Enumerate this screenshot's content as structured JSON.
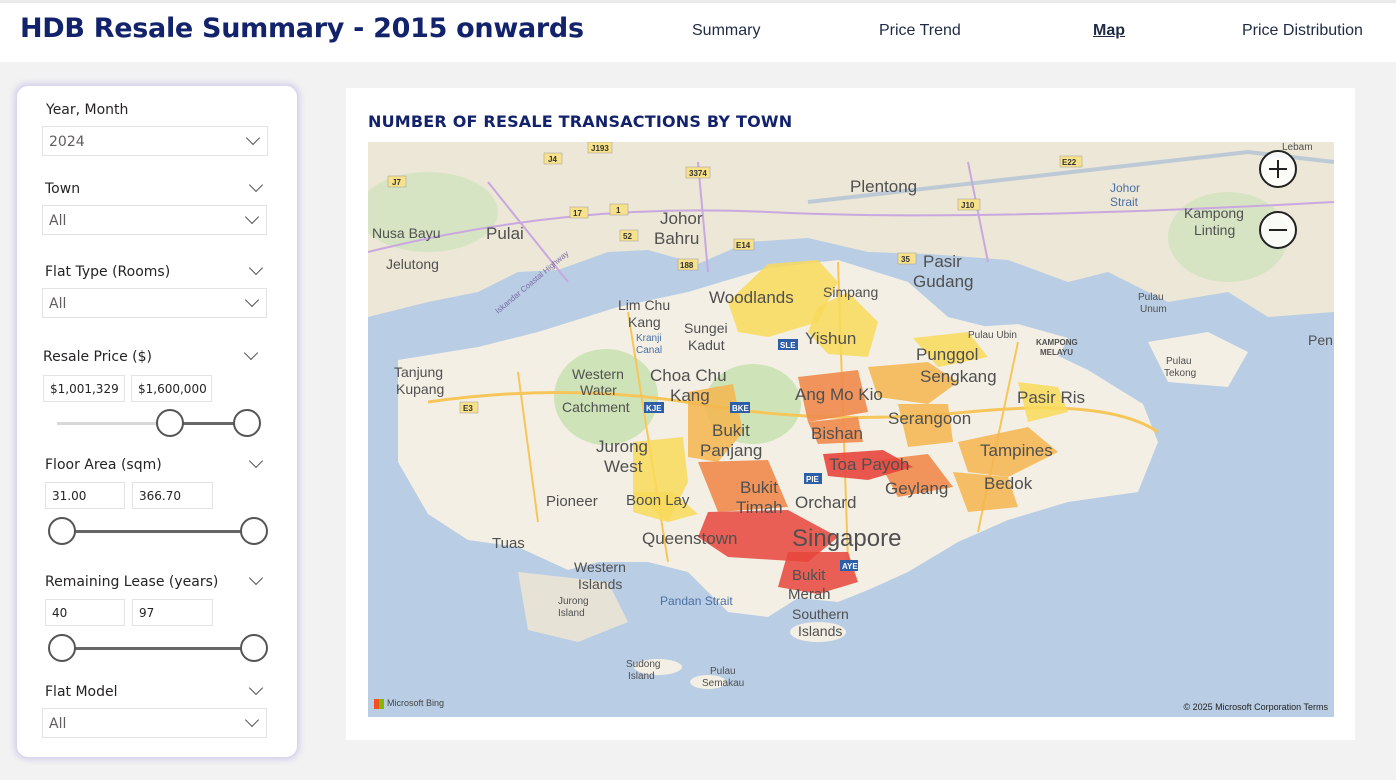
{
  "header": {
    "title": "HDB Resale Summary - 2015 onwards",
    "nav": [
      "Summary",
      "Price Trend",
      "Map",
      "Price Distribution"
    ],
    "active_tab": "Map"
  },
  "filters": {
    "year_month": {
      "label": "Year, Month",
      "value": "2024"
    },
    "town": {
      "label": "Town",
      "value": "All"
    },
    "flat_type": {
      "label": "Flat Type (Rooms)",
      "value": "All"
    },
    "resale_price": {
      "label": "Resale Price ($)",
      "min": "$1,001,329",
      "max": "$1,600,000",
      "low_fraction": 0.6,
      "high_fraction": 1.0
    },
    "floor_area": {
      "label": "Floor Area (sqm)",
      "min": "31.00",
      "max": "366.70",
      "low_fraction": 0.0,
      "high_fraction": 1.0
    },
    "remaining_lease": {
      "label": "Remaining Lease (years)",
      "min": "40",
      "max": "97",
      "low_fraction": 0.0,
      "high_fraction": 1.0
    },
    "flat_model": {
      "label": "Flat Model",
      "value": "All"
    }
  },
  "map_card": {
    "title": "NUMBER OF RESALE TRANSACTIONS BY TOWN",
    "attribution_left": "Microsoft Bing",
    "attribution_right": "© 2025 Microsoft Corporation  Terms",
    "zoom_in_icon": "plus-icon",
    "zoom_out_icon": "minus-icon",
    "place_labels": [
      "Plentong",
      "Johor Bahru",
      "Pulai",
      "Nusa Bayu",
      "Jelutong",
      "Johor Strait",
      "Kampong Linting",
      "Pasir Gudang",
      "Woodlands",
      "Simpang",
      "Yishun",
      "Lim Chu Kang",
      "Sungei Kadut",
      "Kranji Canal",
      "Pulau Ubin",
      "Kampong Melayu",
      "Pulau Unum",
      "Pulau Tekong",
      "Punggol",
      "Sengkang",
      "Tanjung Kupang",
      "Western Water Catchment",
      "Choa Chu Kang",
      "Ang Mo Kio",
      "Serangoon",
      "Pasir Ris",
      "Bishan",
      "Jurong West",
      "Bukit Panjang",
      "Toa Payoh",
      "Tampines",
      "Pioneer",
      "Boon Lay",
      "Bukit Timah",
      "Orchard",
      "Geylang",
      "Bedok",
      "Tuas",
      "Queenstown",
      "Singapore",
      "Western Islands",
      "Jurong Island",
      "Bukit Merah",
      "Pandan Strait",
      "Southern Islands",
      "Sudong Island",
      "Pulau Semakau",
      "Pen",
      "Lebam",
      "Iskandar Coastal Highway"
    ],
    "road_badges": [
      "J193",
      "J4",
      "J7",
      "3374",
      "17",
      "1",
      "52",
      "E14",
      "188",
      "35",
      "J10",
      "E22",
      "E3",
      "KJE",
      "BKE",
      "SLE",
      "PIE",
      "AYE"
    ],
    "colors": {
      "high": "#e8453c",
      "mid_high": "#f08a4b",
      "mid": "#f5b54e",
      "low": "#f8d95a",
      "water": "#b9cde4",
      "land": "#f3efe4"
    }
  }
}
